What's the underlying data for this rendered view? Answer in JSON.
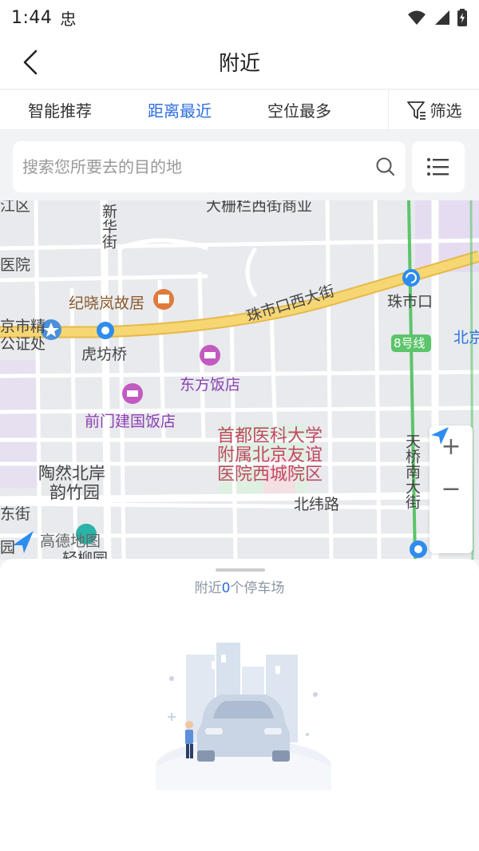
{
  "status_bar": {
    "time": "1:44",
    "extra": "忠"
  },
  "header": {
    "title": "附近"
  },
  "tabs": [
    {
      "label": "智能推荐"
    },
    {
      "label": "距离最近"
    },
    {
      "label": "空位最多"
    }
  ],
  "active_tab": 1,
  "filter": {
    "label": "筛选"
  },
  "search": {
    "placeholder": "搜索您所要去的目的地"
  },
  "map": {
    "labels": {
      "district_top_left": "江区",
      "xinhua_street": "新华街",
      "yuan": "医院",
      "dashilar": "大栅栏西街商业",
      "ji_xiaolan": "纪晓岚故居",
      "zhushikou_west": "珠市口西大街",
      "zhushikou": "珠市口",
      "north_jing": "北京",
      "line8": "8号线",
      "city_notary_1": "京市精",
      "city_notary_2": "公证处",
      "hufangqiao": "虎坊桥",
      "dongfang_hotel": "东方饭店",
      "qianmen_hotel": "前门建国饭店",
      "hospital": "首都医科大学附属北京友谊医院西城院区",
      "taoranbei": "陶然北岸",
      "yunzhuyuan": "韵竹园",
      "dongjie": "东街",
      "beiwei_road": "北纬路",
      "tianqiao": "天桥南大街",
      "yuan_bottom": "园",
      "amap": "高德地图",
      "lianyuan": "轻柳园"
    }
  },
  "sheet": {
    "prefix": "附近",
    "count": "0",
    "suffix": "个停车场"
  },
  "colors": {
    "accent": "#2d6ee0",
    "main_road": "#f7d774",
    "green_line": "#5cc46a",
    "hospital": "#c04a62"
  }
}
